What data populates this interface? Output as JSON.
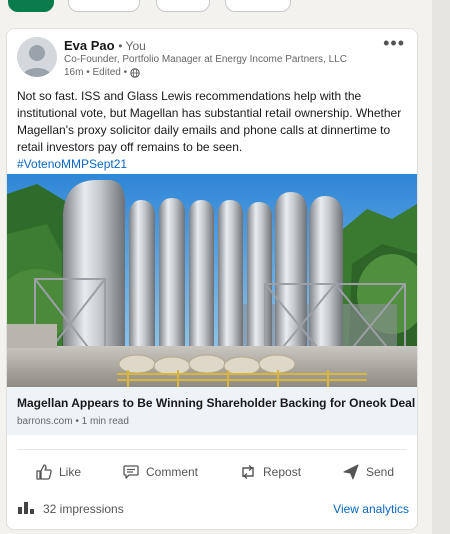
{
  "post": {
    "author_name": "Eva Pao",
    "connection_degree": "• You",
    "headline": "Co-Founder, Portfolio Manager at Energy Income Partners, LLC",
    "timestamp": "16m • Edited •",
    "body": "Not so fast. ISS and Glass Lewis recommendations help with the institutional vote, but Magellan has substantial retail ownership. Whether Magellan's proxy solicitor daily emails and phone calls at dinnertime to retail investors pay off remains to be seen.",
    "hashtag": "#VotenoMMPSept21",
    "more_icon": "more-horizontal-icon",
    "visibility_icon": "globe-icon"
  },
  "link_preview": {
    "title": "Magellan Appears to Be Winning Shareholder Backing for Oneok Deal",
    "source": "barrons.com • 1 min read"
  },
  "actions": {
    "like": "Like",
    "comment": "Comment",
    "repost": "Repost",
    "send": "Send"
  },
  "footer": {
    "impressions": "32 impressions",
    "analytics_link": "View analytics"
  },
  "colors": {
    "link": "#0a66c2",
    "text": "#191919",
    "muted": "#666666",
    "link_box_bg": "#eef3f8"
  }
}
